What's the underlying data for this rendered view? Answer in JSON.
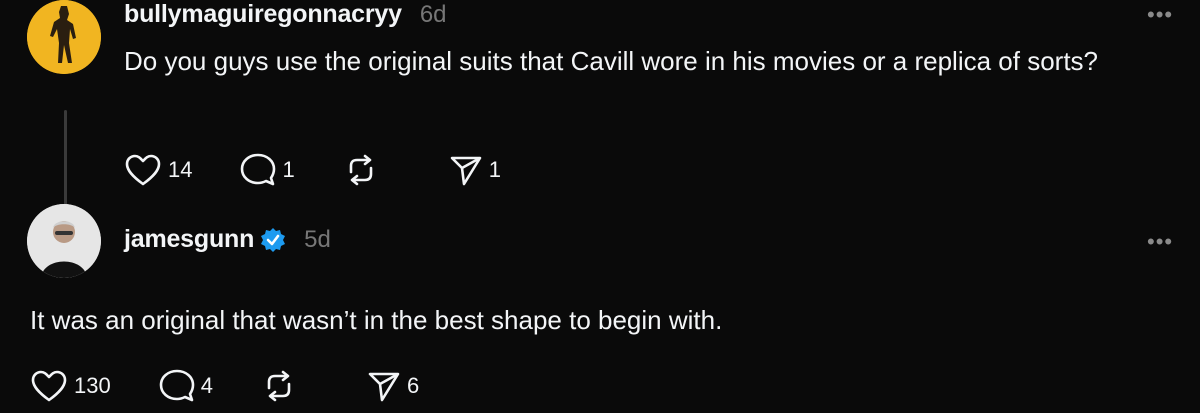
{
  "post1": {
    "username": "bullymaguiregonnacryy",
    "time": "6d",
    "text": "Do you guys use the original suits that Cavill wore in his movies or a replica of sorts?",
    "likes": "14",
    "replies": "1",
    "shares": "1",
    "avatar_color": "#f1b521"
  },
  "post2": {
    "username": "jamesgunn",
    "time": "5d",
    "text": "It was an original that wasn’t in the best shape to begin with.",
    "likes": "130",
    "replies": "4",
    "shares": "6",
    "verified_color": "#1d9bf0"
  },
  "icons": {
    "like": "heart-icon",
    "reply": "comment-bubble-icon",
    "repost": "repost-icon",
    "share": "send-icon",
    "more": "more-options-icon",
    "verified": "verified-badge-icon"
  }
}
